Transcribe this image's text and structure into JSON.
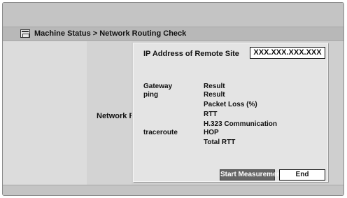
{
  "title_bar": {
    "breadcrumb": "Machine Status > Network Routing Check"
  },
  "side_label": "Network R",
  "dialog": {
    "ip_label": "IP Address of Remote Site",
    "ip_value": "XXX.XXX.XXX.XXX",
    "rows": [
      {
        "label": "Gateway",
        "value": "Result"
      },
      {
        "label": "ping",
        "value": "Result"
      },
      {
        "label": "",
        "value": "Packet Loss (%)"
      },
      {
        "label": "",
        "value": "RTT"
      },
      {
        "label": "",
        "value": "H.323 Communication"
      },
      {
        "label": "traceroute",
        "value": "HOP"
      },
      {
        "label": "",
        "value": "Total RTT"
      }
    ],
    "start_button": "Start Measurement",
    "end_button": "End"
  },
  "colors": {
    "screen_bg": "#c9c9c9",
    "dialog_bg": "#e4e4e4",
    "start_button_bg": "#666666",
    "end_button_bg": "#ffffff"
  }
}
